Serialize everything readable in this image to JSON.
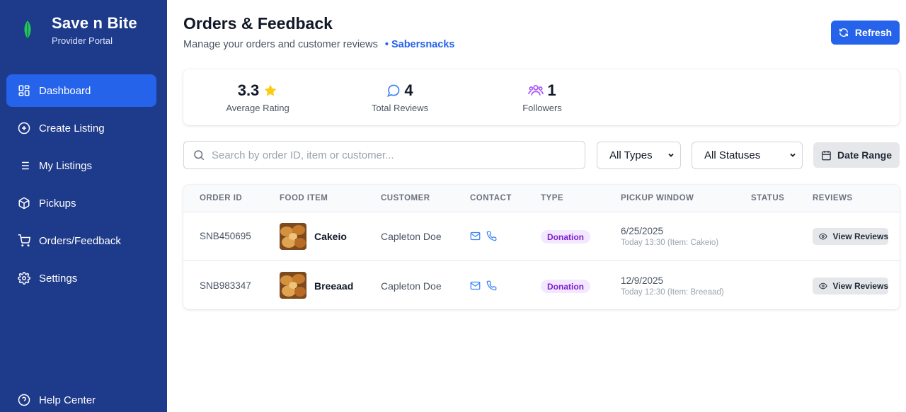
{
  "brand": {
    "title": "Save n Bite",
    "subtitle": "Provider Portal"
  },
  "sidebar": {
    "items": [
      {
        "label": "Dashboard",
        "icon": "dashboard-icon",
        "active": true
      },
      {
        "label": "Create Listing",
        "icon": "plus-circle-icon"
      },
      {
        "label": "My Listings",
        "icon": "list-icon"
      },
      {
        "label": "Pickups",
        "icon": "package-icon"
      },
      {
        "label": "Orders/Feedback",
        "icon": "cart-icon"
      },
      {
        "label": "Settings",
        "icon": "gear-icon"
      }
    ],
    "help": {
      "label": "Help Center",
      "icon": "help-circle-icon"
    }
  },
  "header": {
    "title": "Orders & Feedback",
    "subtitle": "Manage your orders and customer reviews",
    "provider": "• Sabersnacks",
    "refresh_label": "Refresh"
  },
  "stats": {
    "rating": {
      "value": "3.3",
      "label": "Average Rating",
      "icon": "star-icon"
    },
    "reviews": {
      "value": "4",
      "label": "Total Reviews",
      "icon": "chat-bubble-icon"
    },
    "followers": {
      "value": "1",
      "label": "Followers",
      "icon": "users-icon"
    }
  },
  "filters": {
    "search_placeholder": "Search by order ID, item or customer...",
    "type_selected": "All Types",
    "status_selected": "All Statuses",
    "date_label": "Date Range"
  },
  "table": {
    "headers": [
      "ORDER ID",
      "FOOD ITEM",
      "CUSTOMER",
      "CONTACT",
      "TYPE",
      "PICKUP WINDOW",
      "STATUS",
      "REVIEWS"
    ],
    "rows": [
      {
        "order_id": "SNB450695",
        "food": "Cakeio",
        "customer": "Capleton Doe",
        "type": "Donation",
        "pickup_date": "6/25/2025",
        "pickup_note": "Today 13:30 (Item: Cakeio)",
        "status": "",
        "review_label": "View Reviews"
      },
      {
        "order_id": "SNB983347",
        "food": "Breeaad",
        "customer": "Capleton Doe",
        "type": "Donation",
        "pickup_date": "12/9/2025",
        "pickup_note": "Today 12:30 (Item: Breeaad)",
        "status": "",
        "review_label": "View Reviews"
      }
    ]
  },
  "colors": {
    "sidebar": "#1e3a8a",
    "accent": "#2563eb",
    "badge_bg": "#f3e8ff",
    "badge_text": "#7e22ce",
    "star": "#facc15",
    "followers_icon": "#a855f7"
  }
}
